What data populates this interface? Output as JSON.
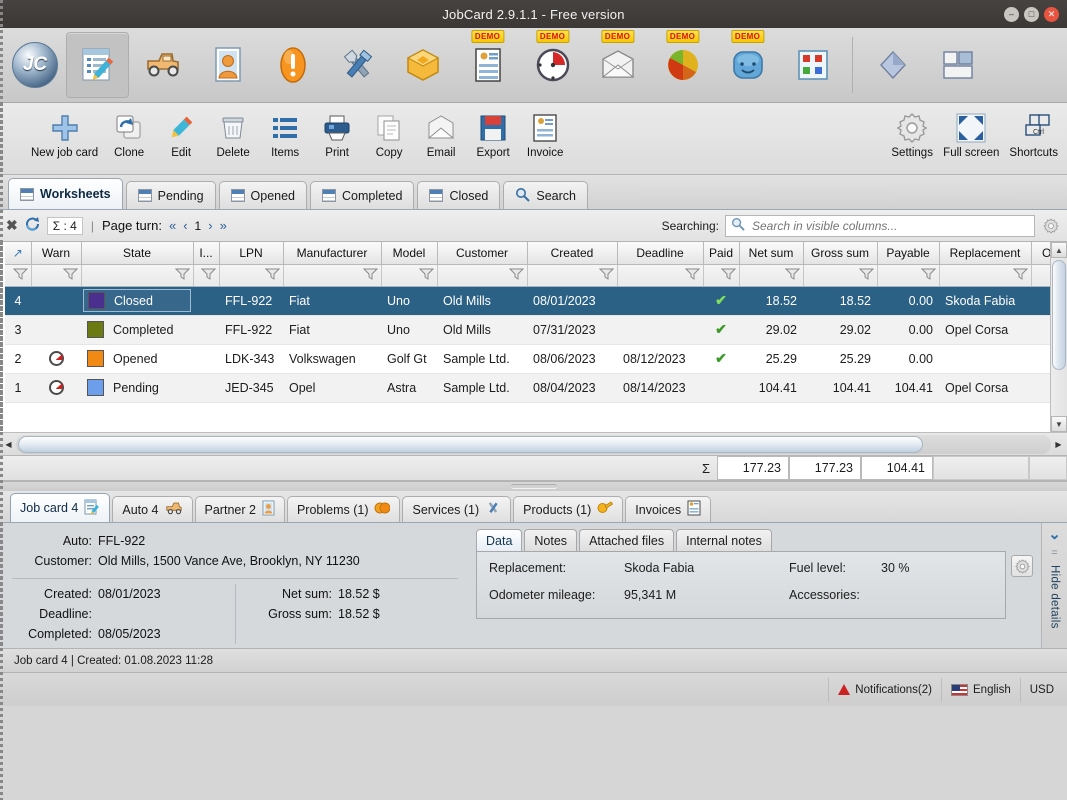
{
  "window": {
    "title": "JobCard 2.9.1.1 - Free version",
    "buttons": {
      "minimize": "–",
      "maximize": "□",
      "close": "✕"
    }
  },
  "icon_toolbar": {
    "logo_text": "JC",
    "demo_badge": "DEMO",
    "items": [
      {
        "name": "job-cards",
        "demo": false
      },
      {
        "name": "autos",
        "demo": false
      },
      {
        "name": "partners",
        "demo": false
      },
      {
        "name": "problems",
        "demo": false
      },
      {
        "name": "services",
        "demo": false
      },
      {
        "name": "products",
        "demo": false
      },
      {
        "name": "invoices",
        "demo": true
      },
      {
        "name": "time-tracking",
        "demo": true
      },
      {
        "name": "mail",
        "demo": true
      },
      {
        "name": "reports",
        "demo": true
      },
      {
        "name": "users",
        "demo": true
      },
      {
        "name": "modules",
        "demo": false
      },
      {
        "name": "diamond",
        "demo": false
      },
      {
        "name": "layout",
        "demo": false
      }
    ]
  },
  "action_toolbar": {
    "items": [
      {
        "label": "New job card",
        "icon": "plus-icon"
      },
      {
        "label": "Clone",
        "icon": "clone-icon"
      },
      {
        "label": "Edit",
        "icon": "pencil-icon"
      },
      {
        "label": "Delete",
        "icon": "trash-icon"
      },
      {
        "label": "Items",
        "icon": "list-icon"
      },
      {
        "label": "Print",
        "icon": "printer-icon"
      },
      {
        "label": "Copy",
        "icon": "copy-icon"
      },
      {
        "label": "Email",
        "icon": "envelope-icon"
      },
      {
        "label": "Export",
        "icon": "floppy-icon"
      },
      {
        "label": "Invoice",
        "icon": "invoice-icon"
      }
    ],
    "right_items": [
      {
        "label": "Settings",
        "icon": "gear-icon"
      },
      {
        "label": "Full screen",
        "icon": "fullscreen-icon"
      },
      {
        "label": "Shortcuts",
        "icon": "keyboard-icon"
      }
    ]
  },
  "tabs": [
    {
      "label": "Worksheets",
      "icon": "sheet-icon",
      "active": true
    },
    {
      "label": "Pending",
      "icon": "sheet-icon",
      "active": false
    },
    {
      "label": "Opened",
      "icon": "sheet-icon",
      "active": false
    },
    {
      "label": "Completed",
      "icon": "sheet-icon",
      "active": false
    },
    {
      "label": "Closed",
      "icon": "sheet-icon",
      "active": false
    },
    {
      "label": "Search",
      "icon": "search-icon",
      "active": false
    }
  ],
  "filter_strip": {
    "clear_icon": "clear-filter-icon",
    "refresh_icon": "refresh-icon",
    "sum_label": "Σ : 4",
    "separator": "|",
    "page_turn_label": "Page turn:",
    "first_arrow": "«",
    "prev_arrow": "‹",
    "page_number": "1",
    "next_arrow": "›",
    "last_arrow": "»",
    "searching_label": "Searching:",
    "search_placeholder": "Search in visible columns...",
    "settings_icon": "gear-icon"
  },
  "grid": {
    "columns": [
      {
        "key": "rownum",
        "label": "..",
        "width": 26,
        "align": "center"
      },
      {
        "key": "warn",
        "label": "Warn",
        "width": 50,
        "align": "center"
      },
      {
        "key": "state",
        "label": "State",
        "width": 112,
        "align": "left"
      },
      {
        "key": "i",
        "label": "I...",
        "width": 26,
        "align": "center"
      },
      {
        "key": "lpn",
        "label": "LPN",
        "width": 64,
        "align": "left"
      },
      {
        "key": "manufacturer",
        "label": "Manufacturer",
        "width": 98,
        "align": "left"
      },
      {
        "key": "model",
        "label": "Model",
        "width": 56,
        "align": "left"
      },
      {
        "key": "customer",
        "label": "Customer",
        "width": 90,
        "align": "left"
      },
      {
        "key": "created",
        "label": "Created",
        "width": 90,
        "align": "left"
      },
      {
        "key": "deadline",
        "label": "Deadline",
        "width": 86,
        "align": "left"
      },
      {
        "key": "paid",
        "label": "Paid",
        "width": 36,
        "align": "center"
      },
      {
        "key": "netsum",
        "label": "Net sum",
        "width": 64,
        "align": "right"
      },
      {
        "key": "grosssum",
        "label": "Gross sum",
        "width": 74,
        "align": "right"
      },
      {
        "key": "payable",
        "label": "Payable",
        "width": 62,
        "align": "right"
      },
      {
        "key": "replacement",
        "label": "Replacement",
        "width": 92,
        "align": "left"
      },
      {
        "key": "od",
        "label": "Od",
        "width": 38,
        "align": "left"
      }
    ],
    "rows": [
      {
        "rownum": "4",
        "warn": "",
        "state": "Closed",
        "state_color": "#4b2f8f",
        "i": "",
        "lpn": "FFL-922",
        "manufacturer": "Fiat",
        "model": "Uno",
        "customer": "Old Mills",
        "created": "08/01/2023",
        "deadline": "",
        "paid": "✔",
        "netsum": "18.52",
        "grosssum": "18.52",
        "payable": "0.00",
        "replacement": "Skoda Fabia",
        "od": "",
        "selected": true
      },
      {
        "rownum": "3",
        "warn": "",
        "state": "Completed",
        "state_color": "#6b7a12",
        "i": "",
        "lpn": "FFL-922",
        "manufacturer": "Fiat",
        "model": "Uno",
        "customer": "Old Mills",
        "created": "07/31/2023",
        "deadline": "",
        "paid": "✔",
        "netsum": "29.02",
        "grosssum": "29.02",
        "payable": "0.00",
        "replacement": "Opel Corsa",
        "od": "",
        "selected": false
      },
      {
        "rownum": "2",
        "warn": "clock-icon",
        "state": "Opened",
        "state_color": "#f08a14",
        "i": "",
        "lpn": "LDK-343",
        "manufacturer": "Volkswagen",
        "model": "Golf Gt",
        "customer": "Sample Ltd.",
        "created": "08/06/2023",
        "deadline": "08/12/2023",
        "paid": "✔",
        "netsum": "25.29",
        "grosssum": "25.29",
        "payable": "0.00",
        "replacement": "",
        "od": "",
        "selected": false
      },
      {
        "rownum": "1",
        "warn": "clock-icon",
        "state": "Pending",
        "state_color": "#6d9eeb",
        "i": "",
        "lpn": "JED-345",
        "manufacturer": "Opel",
        "model": "Astra",
        "customer": "Sample Ltd.",
        "created": "08/04/2023",
        "deadline": "08/14/2023",
        "paid": "",
        "netsum": "104.41",
        "grosssum": "104.41",
        "payable": "104.41",
        "replacement": "Opel Corsa",
        "od": "",
        "selected": false
      }
    ],
    "summary": {
      "sigma": "Σ",
      "netsum": "177.23",
      "grosssum": "177.23",
      "payable": "104.41"
    }
  },
  "detail_tabs": [
    {
      "label": "Job card 4",
      "icon": "jobcard-icon",
      "active": true
    },
    {
      "label": "Auto 4",
      "icon": "car-icon",
      "active": false
    },
    {
      "label": "Partner 2",
      "icon": "person-icon",
      "active": false
    },
    {
      "label": "Problems (1)",
      "icon": "problem-icon",
      "active": false
    },
    {
      "label": "Services (1)",
      "icon": "service-icon",
      "active": false
    },
    {
      "label": "Products (1)",
      "icon": "product-icon",
      "active": false
    },
    {
      "label": "Invoices",
      "icon": "invoice-icon",
      "active": false
    }
  ],
  "detail_left": {
    "auto_label": "Auto:",
    "auto_value": "FFL-922",
    "customer_label": "Customer:",
    "customer_value": "Old Mills, 1500 Vance Ave, Brooklyn, NY 11230",
    "created_label": "Created:",
    "created_value": "08/01/2023",
    "deadline_label": "Deadline:",
    "deadline_value": "",
    "completed_label": "Completed:",
    "completed_value": "08/05/2023",
    "netsum_label": "Net sum:",
    "netsum_value": "18.52 $",
    "grosssum_label": "Gross sum:",
    "grosssum_value": "18.52 $"
  },
  "detail_right": {
    "tabs": [
      {
        "label": "Data",
        "active": true
      },
      {
        "label": "Notes",
        "active": false
      },
      {
        "label": "Attached files",
        "active": false
      },
      {
        "label": "Internal notes",
        "active": false
      }
    ],
    "replacement_label": "Replacement:",
    "replacement_value": "Skoda Fabia",
    "odometer_label": "Odometer mileage:",
    "odometer_value": "95,341 M",
    "fuel_label": "Fuel level:",
    "fuel_value": "30 %",
    "accessories_label": "Accessories:",
    "accessories_value": "",
    "gear_icon": "gear-icon"
  },
  "hide_details": {
    "label": "Hide details",
    "chevron": "chevron-down-icon"
  },
  "status_bar": {
    "text": "Job card 4 | Created: 01.08.2023 11:28"
  },
  "bottom_bar": {
    "notifications": "Notifications(2)",
    "language": "English",
    "currency": "USD"
  }
}
